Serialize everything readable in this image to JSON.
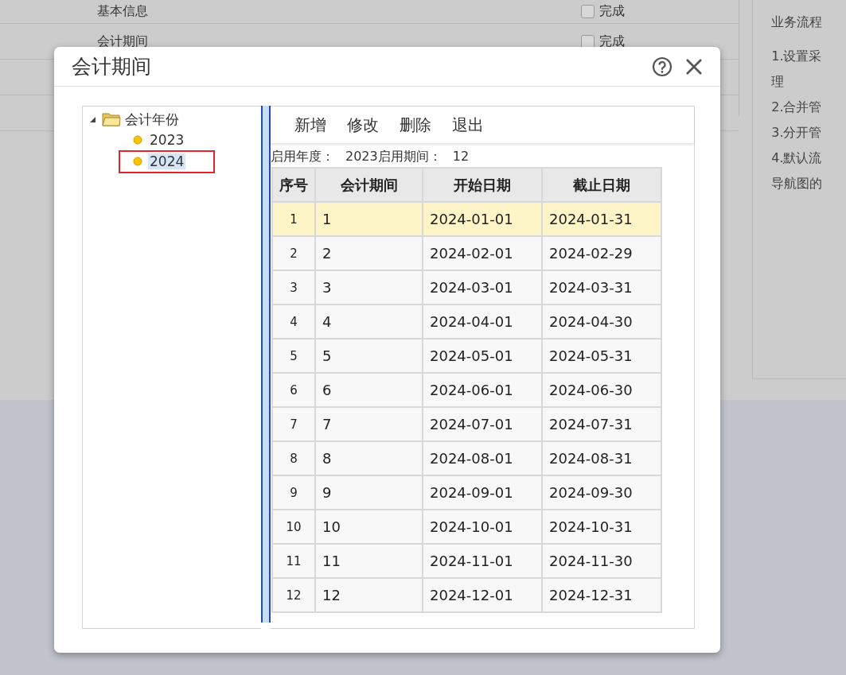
{
  "background": {
    "steps": [
      {
        "label": "基本信息",
        "checkbox": {
          "label": "完成",
          "checked": false
        }
      },
      {
        "label": "会计期间",
        "checkbox": {
          "label": "完成",
          "checked": false
        }
      }
    ],
    "side_panel": {
      "title": "业务流程",
      "lines": [
        "1.设置采",
        "理",
        "2.合并管",
        "3.分开管",
        "4.默认流",
        "导航图的"
      ]
    }
  },
  "dialog": {
    "title": "会计期间",
    "tree": {
      "label": "会计年份",
      "expanded": true,
      "children": [
        {
          "label": "2023",
          "selected": false,
          "marked": false
        },
        {
          "label": "2024",
          "selected": true,
          "marked": true
        }
      ]
    },
    "toolbar": [
      "新增",
      "修改",
      "删除",
      "退出"
    ],
    "info": [
      {
        "label": "启用年度：",
        "value": "2023"
      },
      {
        "label": "启用期间：",
        "value": "12"
      }
    ],
    "table": {
      "columns": [
        "序号",
        "会计期间",
        "开始日期",
        "截止日期"
      ],
      "rows": [
        {
          "cells": [
            "1",
            "1",
            "2024-01-01",
            "2024-01-31"
          ],
          "selected": true
        },
        {
          "cells": [
            "2",
            "2",
            "2024-02-01",
            "2024-02-29"
          ],
          "selected": false
        },
        {
          "cells": [
            "3",
            "3",
            "2024-03-01",
            "2024-03-31"
          ],
          "selected": false
        },
        {
          "cells": [
            "4",
            "4",
            "2024-04-01",
            "2024-04-30"
          ],
          "selected": false
        },
        {
          "cells": [
            "5",
            "5",
            "2024-05-01",
            "2024-05-31"
          ],
          "selected": false
        },
        {
          "cells": [
            "6",
            "6",
            "2024-06-01",
            "2024-06-30"
          ],
          "selected": false
        },
        {
          "cells": [
            "7",
            "7",
            "2024-07-01",
            "2024-07-31"
          ],
          "selected": false
        },
        {
          "cells": [
            "8",
            "8",
            "2024-08-01",
            "2024-08-31"
          ],
          "selected": false
        },
        {
          "cells": [
            "9",
            "9",
            "2024-09-01",
            "2024-09-30"
          ],
          "selected": false
        },
        {
          "cells": [
            "10",
            "10",
            "2024-10-01",
            "2024-10-31"
          ],
          "selected": false
        },
        {
          "cells": [
            "11",
            "11",
            "2024-11-01",
            "2024-11-30"
          ],
          "selected": false
        },
        {
          "cells": [
            "12",
            "12",
            "2024-12-01",
            "2024-12-31"
          ],
          "selected": false
        }
      ]
    }
  }
}
